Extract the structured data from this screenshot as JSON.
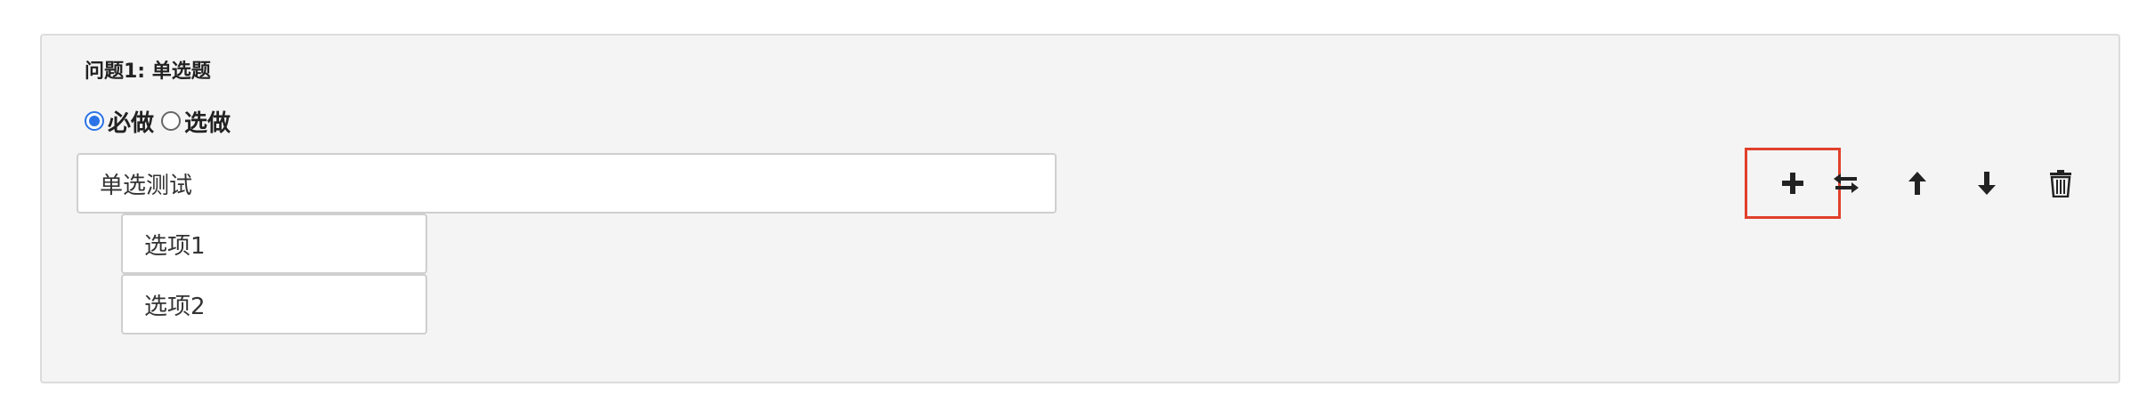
{
  "question": {
    "title": "问题1: 单选题",
    "required_label": "必做",
    "optional_label": "选做",
    "required_selected": true,
    "text_value": "单选测试",
    "options": [
      {
        "value": "选项1"
      },
      {
        "value": "选项2"
      }
    ]
  },
  "toolbar": {
    "icons": [
      "plus-icon",
      "swap-icon",
      "arrow-up-icon",
      "arrow-down-icon",
      "trash-icon"
    ],
    "highlight_color": "#e0402c"
  },
  "colors": {
    "panel_bg": "#f4f4f4",
    "radio_accent": "#2b73e6"
  }
}
